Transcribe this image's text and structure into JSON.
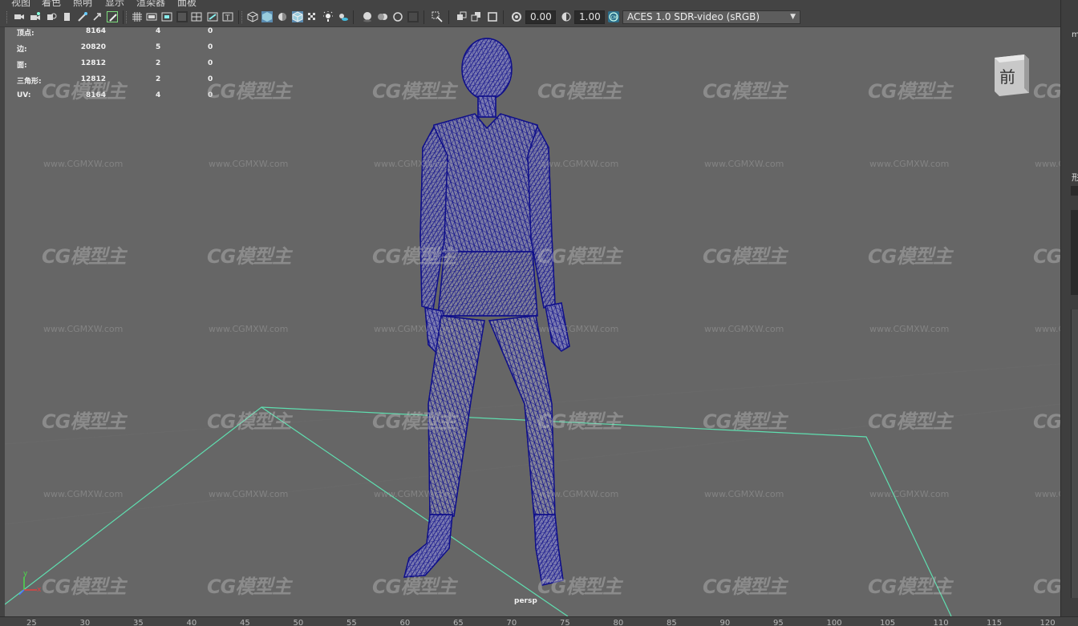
{
  "menu": [
    "视图",
    "着色",
    "照明",
    "显示",
    "渲染器",
    "面板"
  ],
  "toolbar": {
    "exposure_value": "0.00",
    "gamma_value": "1.00",
    "color_space": "ACES 1.0 SDR-video (sRGB)"
  },
  "hud": {
    "rows": [
      {
        "label": "顶点:",
        "total": "8164",
        "selected": "4",
        "tri": "0"
      },
      {
        "label": "边:",
        "total": "20820",
        "selected": "5",
        "tri": "0"
      },
      {
        "label": "面:",
        "total": "12812",
        "selected": "2",
        "tri": "0"
      },
      {
        "label": "三角形:",
        "total": "12812",
        "selected": "2",
        "tri": "0"
      },
      {
        "label": "UV:",
        "total": "8164",
        "selected": "4",
        "tri": "0"
      }
    ]
  },
  "viewport": {
    "camera_label": "persp",
    "view_cube_face": "前",
    "axis_x": "x",
    "axis_y": "y"
  },
  "watermark": {
    "logo_text": "CG模型主",
    "url_text": "www.CGMXW.com"
  },
  "right_panel": {
    "label_1": "m",
    "label_2": "形"
  },
  "timeline_ruler": [
    "25",
    "30",
    "35",
    "40",
    "45",
    "50",
    "55",
    "60",
    "65",
    "70",
    "75",
    "80",
    "85",
    "90",
    "95",
    "100",
    "105",
    "110",
    "115",
    "120"
  ],
  "colors": {
    "wireframe": "#10108a",
    "ground_outline": "#5fdfb0",
    "viewport_bg": "#666666",
    "ui_bg": "#444444"
  }
}
